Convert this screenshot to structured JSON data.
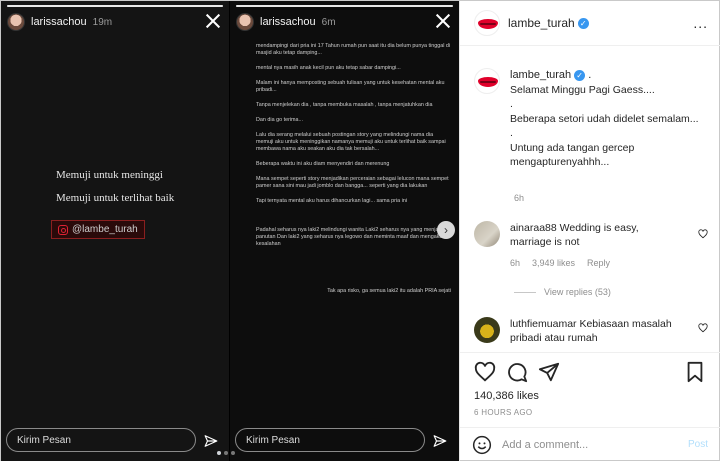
{
  "story_left": {
    "username": "larissachou",
    "time": "19m",
    "line1": "Memuji untuk meninggi",
    "line2": "Memuji untuk terlihat baik",
    "tag": "@lambe_turah",
    "message_placeholder": "Kirim Pesan"
  },
  "story_right": {
    "username": "larissachou",
    "time": "6m",
    "paragraphs": [
      "mendampingi dari pria ini 17 Tahun rumah pun saat itu dia belum punya tinggal di masjid aku tetap damping...",
      "mental nya masih anak kecil pun aku tetap sabar dampingi...",
      "Malam ini hanya memposting sebuah tulisan yang untuk kesehatan mental aku pribadi...",
      "Tanpa menjelekan dia , tanpa membuka masalah , tanpa menjatuhkan dia",
      "Dan dia go terima...",
      "Lalu dia serang melalui sebuah postingan story yang melindungi nama dia memuji aku untuk meninggikan namanya memuji aku untuk terlihat baik sampai membawa nama aku seakan aku dia tak bersalah...",
      "Beberapa waktu ini aku diam menyendiri dan merenung",
      "Mana sempet seperti story menjadikan perceraian sebagai lelucon mana sempet pamer sana sini mau jadi jomblo dan bangga... seperti yang dia lakukan",
      "Tapi ternyata mental aku harus dihancurkan lagi... sama pria ini",
      "Padahal seharus nya laki2 melindungi wanita Laki2 seharus nya yang menjadi panutan Dan laki2 yang seharus nya legowo dan meminta maaf dan mengakui kesalahan",
      "Tak apa risko, ga semua laki2 itu adalah PRIA sejati"
    ],
    "message_placeholder": "Kirim Pesan"
  },
  "post": {
    "username": "lambe_turah",
    "caption_user": "lambe_turah",
    "caption_lines": [
      "Selamat Minggu Pagi Gaess....",
      ".",
      "Beberapa setori udah didelet semalam...",
      ".",
      "Untung ada tangan gercep mengapturenyahhh..."
    ],
    "caption_time": "6h",
    "comments": [
      {
        "user": "ainaraa88",
        "text": "Wedding is easy, marriage is not",
        "time": "6h",
        "likes": "3,949 likes",
        "reply": "Reply"
      },
      {
        "user": "luthfiemuamar",
        "text": "Kebiasaan masalah pribadi atau rumah"
      }
    ],
    "view_replies": "View replies (53)",
    "likes_count": "140,386 likes",
    "posted_ago": "6 HOURS AGO",
    "add_comment_placeholder": "Add a comment...",
    "post_label": "Post",
    "more_label": "..."
  },
  "icons": {
    "heart": "heart-icon",
    "comment": "comment-icon",
    "share": "paper-plane-icon",
    "bookmark": "bookmark-icon",
    "emoji": "smiley-icon",
    "close": "close-icon",
    "next": "chevron-right-icon"
  },
  "colors": {
    "verified": "#3897f0",
    "brand_red": "#e0002a",
    "post_disabled": "#b2dffc"
  }
}
